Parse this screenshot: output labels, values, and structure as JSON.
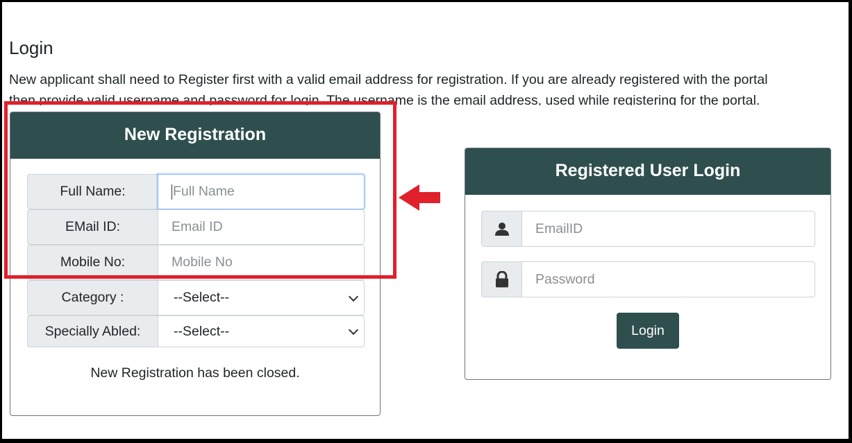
{
  "page": {
    "title": "Login",
    "intro_line1": "New applicant shall need to Register first with a valid email address for registration. If you are already registered with the portal",
    "intro_line2": "then provide valid username and password for login. The username is the email address, used while registering for the portal."
  },
  "registration": {
    "header": "New Registration",
    "fields": [
      {
        "label": "Full Name:",
        "placeholder": "Full Name"
      },
      {
        "label": "EMail ID:",
        "placeholder": "Email ID"
      },
      {
        "label": "Mobile No:",
        "placeholder": "Mobile No"
      }
    ],
    "selects": [
      {
        "label": "Category :",
        "value": "--Select--"
      },
      {
        "label": "Specially Abled:",
        "value": "--Select--"
      }
    ],
    "closed_message": "New Registration has been closed."
  },
  "login": {
    "header": "Registered User Login",
    "email_placeholder": "EmailID",
    "password_placeholder": "Password",
    "button_label": "Login",
    "icons": [
      "user-icon",
      "lock-icon"
    ]
  },
  "colors": {
    "header_bg": "#2f4f4f",
    "highlight_red": "#e0202b",
    "addon_bg": "#e9ecef"
  }
}
